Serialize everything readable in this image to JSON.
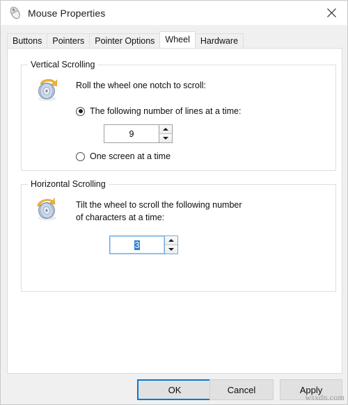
{
  "window": {
    "title": "Mouse Properties",
    "title_icon": "mouse-icon",
    "close_icon": "close-icon"
  },
  "tabs": [
    {
      "label": "Buttons",
      "active": false
    },
    {
      "label": "Pointers",
      "active": false
    },
    {
      "label": "Pointer Options",
      "active": false
    },
    {
      "label": "Wheel",
      "active": true
    },
    {
      "label": "Hardware",
      "active": false
    }
  ],
  "vertical_scrolling": {
    "group_label": "Vertical Scrolling",
    "icon": "scroll-wheel-vertical-icon",
    "description": "Roll the wheel one notch to scroll:",
    "option_lines": {
      "label": "The following number of lines at a time:",
      "checked": true
    },
    "lines_value": "9",
    "spin_up_icon": "arrow-up-icon",
    "spin_down_icon": "arrow-down-icon",
    "option_screen": {
      "label": "One screen at a time",
      "checked": false
    }
  },
  "horizontal_scrolling": {
    "group_label": "Horizontal Scrolling",
    "icon": "scroll-wheel-horizontal-icon",
    "description_line1": "Tilt the wheel to scroll the following number",
    "description_line2": "of characters at a time:",
    "characters_value": "3",
    "spin_up_icon": "arrow-up-icon",
    "spin_down_icon": "arrow-down-icon"
  },
  "buttons": {
    "ok": "OK",
    "cancel": "Cancel",
    "apply": "Apply"
  },
  "watermark": "wsxdn.com",
  "colors": {
    "accent": "#0078d7",
    "selection": "#2f7fd1",
    "window_bg": "#f0f0f0",
    "page_bg": "#ffffff",
    "wheel_orange": "#f0a830"
  }
}
